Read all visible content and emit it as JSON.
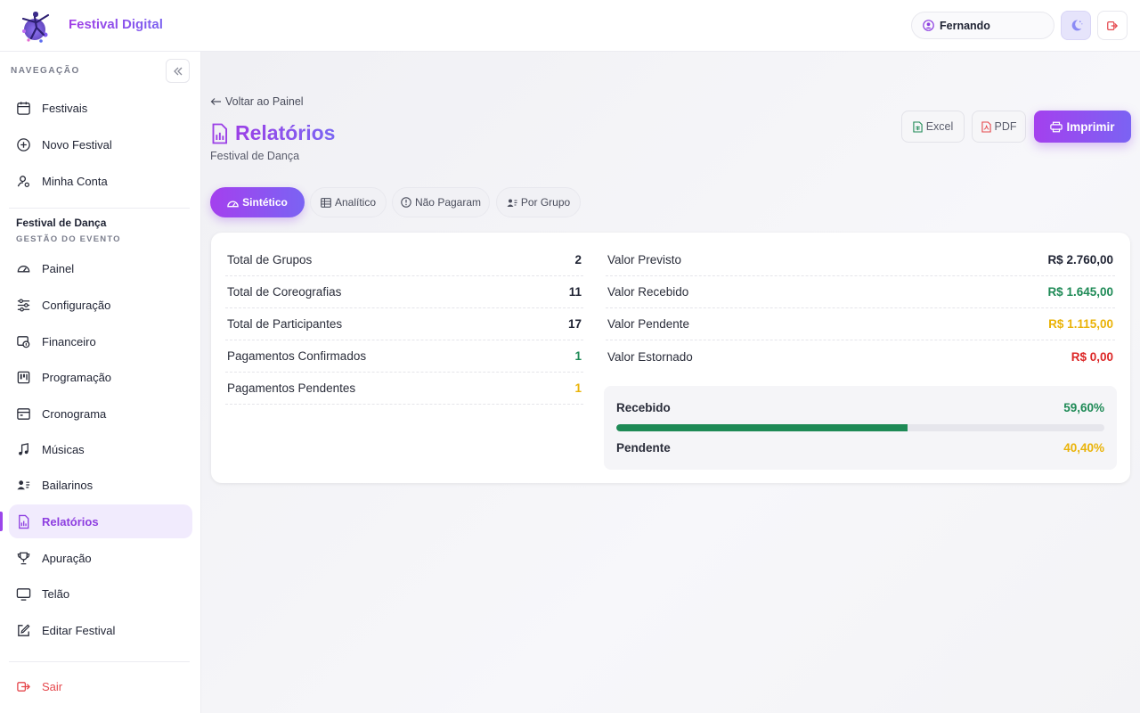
{
  "header": {
    "app_title": "Festival Digital",
    "user_name": "Fernando"
  },
  "sidebar": {
    "nav_heading": "NAVEGAÇÃO",
    "top_items": [
      {
        "label": "Festivais",
        "icon": "calendar-icon"
      },
      {
        "label": "Novo Festival",
        "icon": "plus-circle-icon"
      },
      {
        "label": "Minha Conta",
        "icon": "user-settings-icon"
      }
    ],
    "event_name": "Festival de Dança",
    "event_section": "GESTÃO DO EVENTO",
    "event_items": [
      {
        "label": "Painel",
        "icon": "dashboard-gauge-icon"
      },
      {
        "label": "Configuração",
        "icon": "sliders-icon"
      },
      {
        "label": "Financeiro",
        "icon": "money-icon"
      },
      {
        "label": "Programação",
        "icon": "schedule-icon"
      },
      {
        "label": "Cronograma",
        "icon": "calendar-grid-icon"
      },
      {
        "label": "Músicas",
        "icon": "music-note-icon"
      },
      {
        "label": "Bailarinos",
        "icon": "users-list-icon"
      },
      {
        "label": "Relatórios",
        "icon": "report-icon"
      },
      {
        "label": "Apuração",
        "icon": "trophy-icon"
      },
      {
        "label": "Telão",
        "icon": "monitor-icon"
      },
      {
        "label": "Editar Festival",
        "icon": "edit-icon"
      }
    ],
    "exit_label": "Sair"
  },
  "main": {
    "back_link": "Voltar ao Painel",
    "title": "Relatórios",
    "subtitle": "Festival de Dança",
    "buttons": {
      "excel": "Excel",
      "pdf": "PDF",
      "print": "Imprimir"
    },
    "tabs": [
      "Sintético",
      "Analítico",
      "Não Pagaram",
      "Por Grupo"
    ],
    "left_stats": [
      {
        "label": "Total de Grupos",
        "value": "2"
      },
      {
        "label": "Total de Coreografias",
        "value": "11"
      },
      {
        "label": "Total de Participantes",
        "value": "17"
      },
      {
        "label": "Pagamentos Confirmados",
        "value": "1"
      },
      {
        "label": "Pagamentos Pendentes",
        "value": "1"
      }
    ],
    "right_stats": [
      {
        "label": "Valor Previsto",
        "value": "R$ 2.760,00"
      },
      {
        "label": "Valor Recebido",
        "value": "R$ 1.645,00"
      },
      {
        "label": "Valor Pendente",
        "value": "R$ 1.115,00"
      },
      {
        "label": "Valor Estornado",
        "value": "R$ 0,00"
      }
    ],
    "progress": {
      "received_label": "Recebido",
      "received_value": "59,60%",
      "received_fraction": 0.596,
      "pending_label": "Pendente",
      "pending_value": "40,40%"
    }
  },
  "colors": {
    "accent": "#9b45ea",
    "green": "#1e8a56",
    "yellow": "#eab308",
    "red": "#dc2626"
  }
}
